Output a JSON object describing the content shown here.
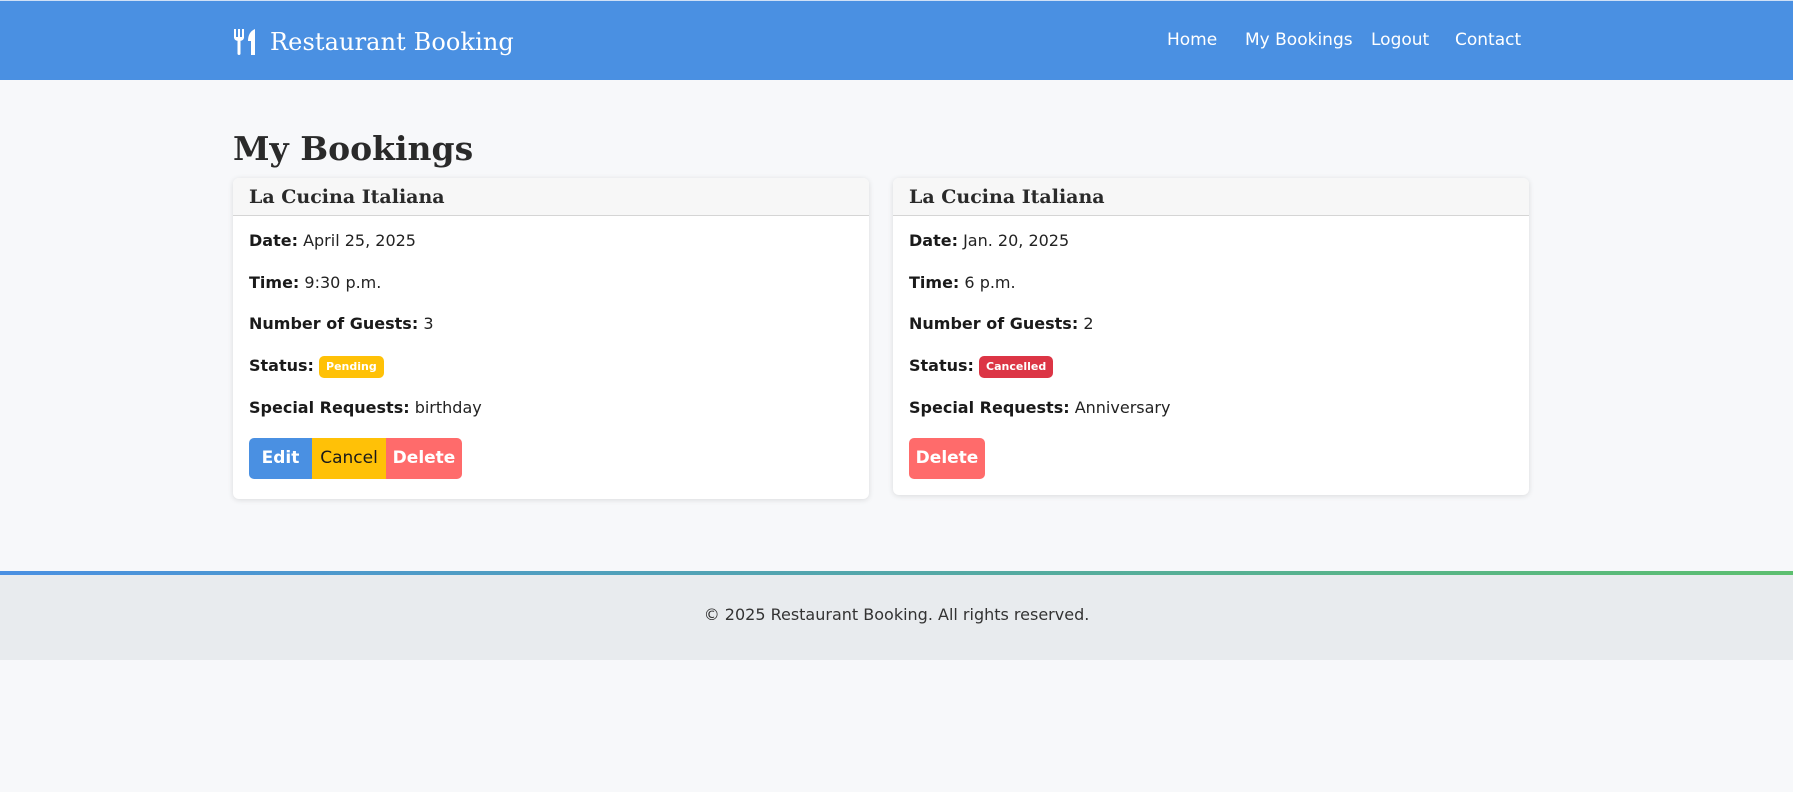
{
  "navbar": {
    "brand": "Restaurant Booking",
    "brand_icon": "utensils-icon",
    "links": [
      {
        "label": "Home"
      },
      {
        "label": "My Bookings"
      },
      {
        "label": "Logout"
      },
      {
        "label": "Contact"
      }
    ]
  },
  "page": {
    "title": "My Bookings"
  },
  "bookings": [
    {
      "restaurant": "La Cucina Italiana",
      "date_label": "Date:",
      "date": "April 25, 2025",
      "time_label": "Time:",
      "time": "9:30 p.m.",
      "guests_label": "Number of Guests:",
      "guests": "3",
      "status_label": "Status:",
      "status": "Pending",
      "status_color": "#ffc107",
      "requests_label": "Special Requests:",
      "requests": "birthday",
      "buttons": {
        "edit": "Edit",
        "cancel": "Cancel",
        "delete": "Delete"
      }
    },
    {
      "restaurant": "La Cucina Italiana",
      "date_label": "Date:",
      "date": "Jan. 20, 2025",
      "time_label": "Time:",
      "time": "6 p.m.",
      "guests_label": "Number of Guests:",
      "guests": "2",
      "status_label": "Status:",
      "status": "Cancelled",
      "status_color": "#dc3545",
      "requests_label": "Special Requests:",
      "requests": "Anniversary",
      "buttons": {
        "delete": "Delete"
      }
    }
  ],
  "footer": {
    "text": "© 2025 Restaurant Booking. All rights reserved."
  },
  "colors": {
    "primary": "#4a90e2",
    "warning": "#ffc107",
    "danger": "#dc3545",
    "delete": "#ff6b6b",
    "footer_gradient_end": "#5cbf6f"
  }
}
